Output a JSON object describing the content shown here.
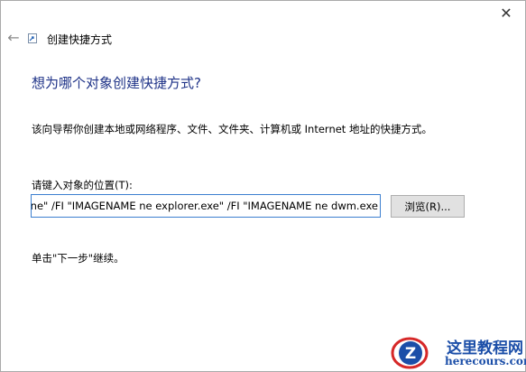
{
  "window": {
    "title": "创建快捷方式",
    "close_glyph": "✕",
    "back_glyph": "←"
  },
  "main": {
    "heading": "想为哪个对象创建快捷方式?",
    "description": "该向导帮你创建本地或网络程序、文件、文件夹、计算机或 Internet 地址的快捷方式。",
    "location_label": "请键入对象的位置(T):",
    "location_value": "ne\" /FI \"IMAGENAME ne explorer.exe\" /FI \"IMAGENAME ne dwm.exe",
    "browse_label": "浏览(R)...",
    "continue_text": "单击\"下一步\"继续。"
  },
  "watermark": {
    "logo_letter": "Z",
    "title": "这里教程网",
    "url": "herecours.com"
  },
  "colors": {
    "heading": "#1e3287",
    "input_border": "#3c7fd0",
    "watermark": "#1b4ea8",
    "watermark_accent": "#d62828"
  }
}
